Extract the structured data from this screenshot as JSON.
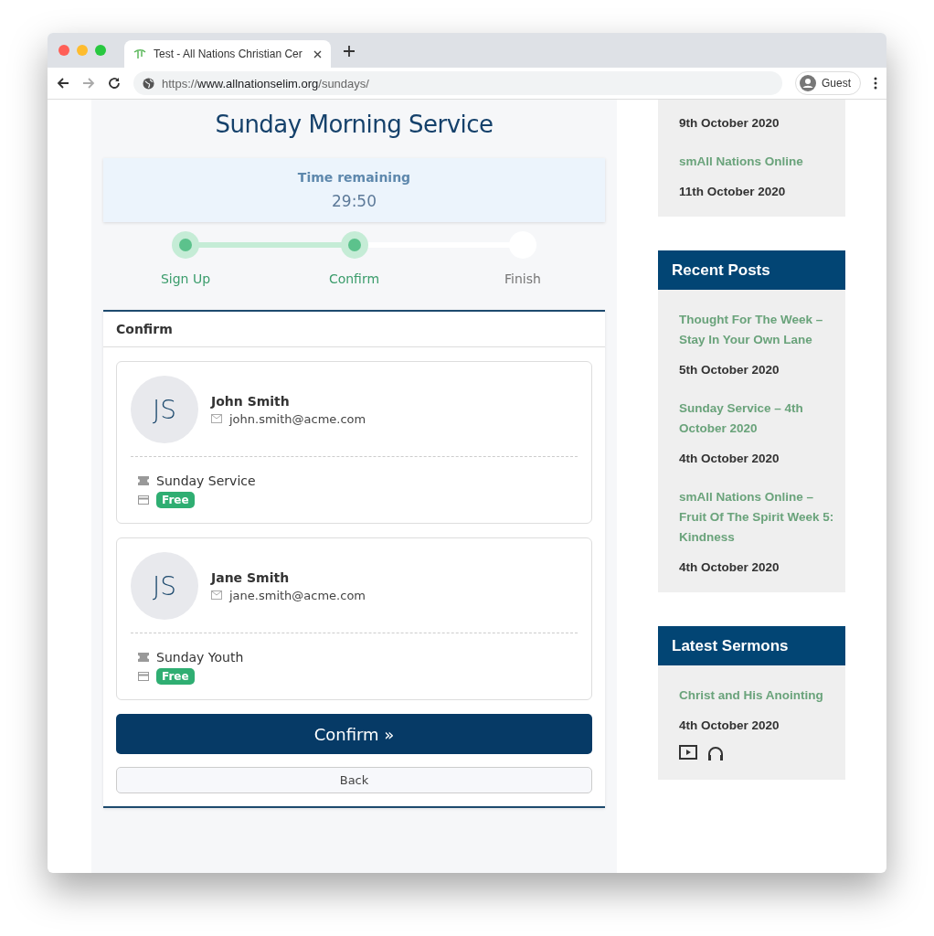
{
  "browser": {
    "tab_title": "Test - All Nations Christian Cer",
    "url_prefix": "https://",
    "url_host": "www.allnationselim.org",
    "url_path": "/sundays/",
    "profile": "Guest"
  },
  "main": {
    "title": "Sunday Morning Service",
    "timer": {
      "label": "Time remaining",
      "value": "29:50"
    },
    "steps": [
      {
        "label": "Sign Up",
        "completed": true
      },
      {
        "label": "Confirm",
        "completed": true
      },
      {
        "label": "Finish",
        "completed": false
      }
    ],
    "panel": {
      "heading": "Confirm",
      "attendees": [
        {
          "initials": "JS",
          "name": "John Smith",
          "email": "john.smith@acme.com",
          "ticket": "Sunday Service",
          "price": "Free"
        },
        {
          "initials": "JS",
          "name": "Jane Smith",
          "email": "jane.smith@acme.com",
          "ticket": "Sunday Youth",
          "price": "Free"
        }
      ],
      "confirm_button": "Confirm »",
      "back_button": "Back"
    }
  },
  "sidebar": [
    {
      "items": [
        {
          "date": "9th October 2020"
        },
        {
          "title": "smAll Nations Online",
          "date": "11th October 2020"
        }
      ]
    },
    {
      "heading": "Recent Posts",
      "items": [
        {
          "title": "Thought For The Week – Stay In Your Own Lane",
          "date": "5th October 2020"
        },
        {
          "title": "Sunday Service – 4th October 2020",
          "date": "4th October 2020"
        },
        {
          "title": "smAll Nations Online – Fruit Of The Spirit Week 5: Kindness",
          "date": "4th October 2020"
        }
      ]
    },
    {
      "heading": "Latest Sermons",
      "items": [
        {
          "title": "Christ and His Anointing",
          "date": "4th October 2020",
          "media": [
            {
              "kind": "video"
            },
            {
              "kind": "audio"
            }
          ]
        }
      ]
    }
  ]
}
